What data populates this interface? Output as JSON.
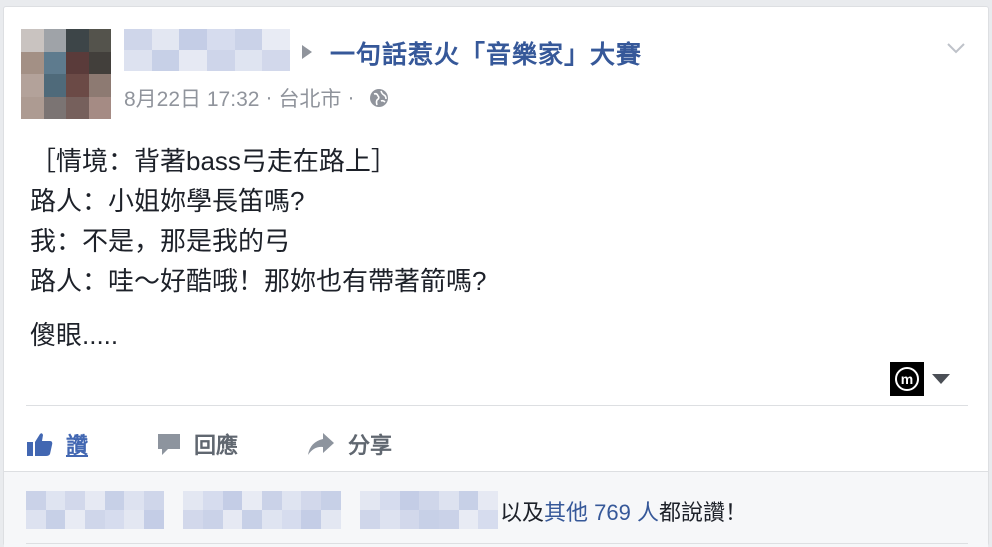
{
  "post": {
    "group_name": "一句話惹火「音樂家」大賽",
    "timestamp": "8月22日 17:32",
    "location": "台北市",
    "meta_separator": "·",
    "privacy_icon": "globe-icon",
    "lines": [
      "［情境：背著bass弓走在路上］",
      "路人：小姐妳學長笛嗎?",
      "我：不是，那是我的弓",
      "路人：哇～好酷哦！那妳也有帶著箭嗎?"
    ],
    "final_line": "傻眼....."
  },
  "actions": {
    "like_label": "讚",
    "comment_label": "回應",
    "share_label": "分享"
  },
  "footer": {
    "prefix": "以及",
    "others_link": "其他 769 人",
    "suffix": "都說讚！"
  },
  "colors": {
    "link_blue": "#365899",
    "like_blue": "#4267b2",
    "meta_gray": "#90949c",
    "action_gray": "#606770"
  }
}
